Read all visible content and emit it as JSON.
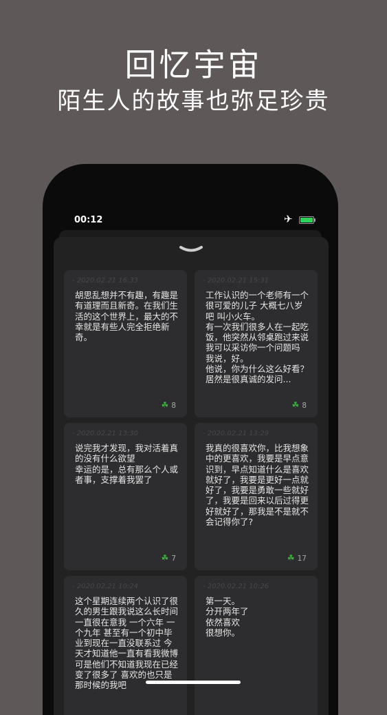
{
  "promo": {
    "title": "回忆宇宙",
    "subtitle": "陌生人的故事也弥足珍贵"
  },
  "status_bar": {
    "time": "00:12"
  },
  "cards": [
    {
      "date": "- 2020.02.21 16:33",
      "text": "胡思乱想并不有趣，有趣是有道理而且新奇。在我们生活的这个世界上，最大的不幸就是有些人完全拒绝新奇。",
      "likes": "8"
    },
    {
      "date": "- 2020.02.21 15:31",
      "text": "工作认识的一个老师有一个很可爱的儿子 大概七八岁吧 叫小火车。\n有一次我们很多人在一起吃饭，他突然从邻桌跑过来说 我可以采访你一个问题吗\n我说，好。\n他说，你为什么这么好看？\n居然是很真诚的发问...",
      "likes": "8"
    },
    {
      "date": "- 2020.02.21 13:30",
      "text": "说完我才发现，我对活着真的没有什么欲望\n幸运的是，总有那么个人或者事，支撑着我罢了",
      "likes": "7"
    },
    {
      "date": "- 2020.02.21 13:29",
      "text": "我真的很喜欢你，比我想象中的更喜欢，我要是早点意识到，早点知道什么是喜欢就好了，我要是更好一点就好了，我要是勇敢一些就好了，我要是回来以后过得更好就好了，那我是不是就不会记得你了?",
      "likes": "17"
    },
    {
      "date": "- 2020.02.21 10:24",
      "text": "这个星期连续两个认识了很久的男生跟我说这么长时间一直很在意我 一个六年 一个九年 甚至有一个初中毕业到现在一直没联系过 今天才知道他一直有看我微博 可是他们不知道我现在已经变了很多了 喜欢的也只是那时候的我吧",
      "likes": ""
    },
    {
      "date": "- 2020.02.21 10:26",
      "text": "第一天。\n分开两年了\n依然喜欢\n很想你。",
      "likes": ""
    }
  ]
}
